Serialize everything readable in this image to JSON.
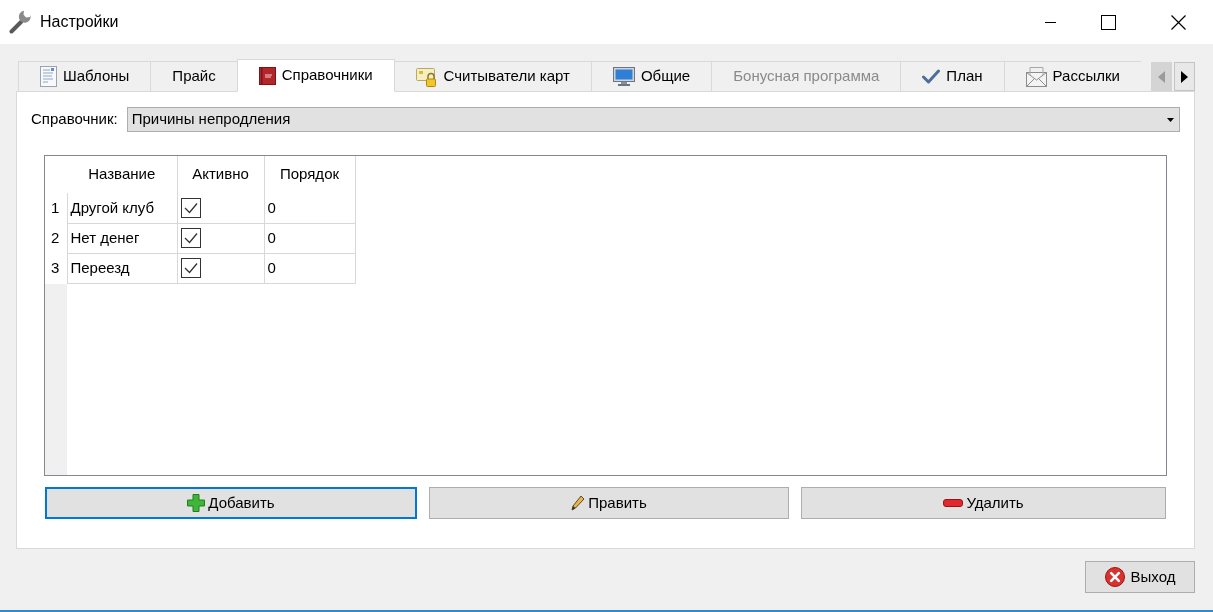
{
  "window": {
    "title": "Настройки"
  },
  "tabs": [
    {
      "label": "Шаблоны",
      "selected": false,
      "disabled": false
    },
    {
      "label": "Прайс",
      "selected": false,
      "disabled": false
    },
    {
      "label": "Справочники",
      "selected": true,
      "disabled": false
    },
    {
      "label": "Считыватели карт",
      "selected": false,
      "disabled": false
    },
    {
      "label": "Общие",
      "selected": false,
      "disabled": false
    },
    {
      "label": "Бонусная программа",
      "selected": false,
      "disabled": true
    },
    {
      "label": "План",
      "selected": false,
      "disabled": false
    },
    {
      "label": "Рассылки",
      "selected": false,
      "disabled": false
    }
  ],
  "tab_scroll_buttons": [
    {
      "disabled": true
    },
    {
      "disabled": false
    }
  ],
  "directory_field": {
    "label": "Справочник:",
    "value": "Причины непродления"
  },
  "table": {
    "columns": [
      "Название",
      "Активно",
      "Порядок"
    ],
    "rows": [
      {
        "number": "1",
        "name": "Другой клуб",
        "active": true,
        "order": "0"
      },
      {
        "number": "2",
        "name": "Нет денег",
        "active": true,
        "order": "0"
      },
      {
        "number": "3",
        "name": "Переезд",
        "active": true,
        "order": "0"
      }
    ]
  },
  "buttons": [
    {
      "label": "Добавить",
      "focused": true
    },
    {
      "label": "Править",
      "focused": false
    },
    {
      "label": "Удалить",
      "focused": false
    }
  ],
  "exit_button": {
    "label": "Выход"
  }
}
